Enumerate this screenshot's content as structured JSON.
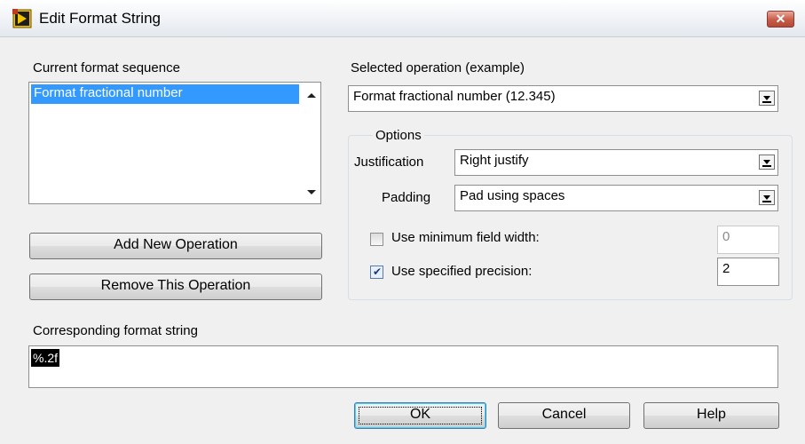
{
  "window": {
    "title": "Edit Format String",
    "close_label": "✕",
    "icon": "labview-app-icon"
  },
  "left": {
    "sequence_label": "Current format sequence",
    "sequence_items": [
      "Format fractional number"
    ],
    "add_button": "Add New Operation",
    "remove_button": "Remove This Operation"
  },
  "right": {
    "selected_label": "Selected operation (example)",
    "selected_value": "Format fractional number (12.345)",
    "options_label": "Options",
    "justification_label": "Justification",
    "justification_value": "Right justify",
    "padding_label": "Padding",
    "padding_value": "Pad using spaces",
    "min_width_label": "Use minimum field width:",
    "min_width_checked": false,
    "min_width_value": "0",
    "precision_label": "Use specified precision:",
    "precision_checked": true,
    "precision_value": "2"
  },
  "format_string": {
    "label": "Corresponding format string",
    "value": "%.2f"
  },
  "buttons": {
    "ok": "OK",
    "cancel": "Cancel",
    "help": "Help"
  },
  "colors": {
    "selection": "#3399ff",
    "close_button": "#c75c48"
  }
}
